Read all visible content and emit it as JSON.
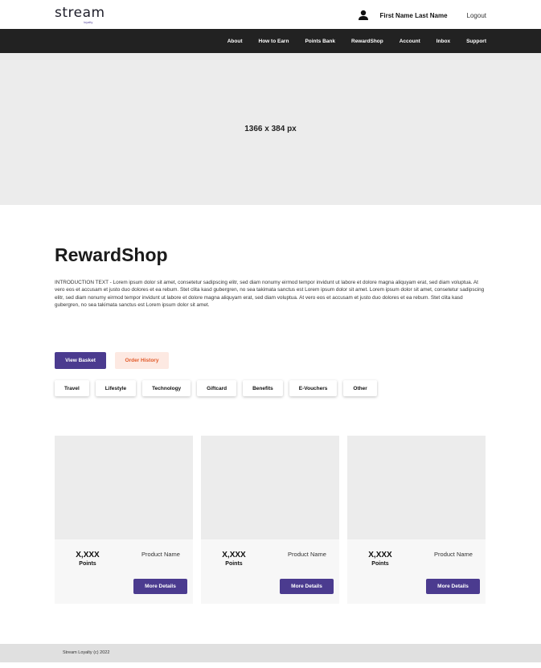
{
  "header": {
    "logo_text": "stream",
    "logo_sub": "loyalty",
    "user_icon": "user-icon",
    "user_name": "First Name Last Name",
    "logout": "Logout"
  },
  "nav": {
    "items": [
      "About",
      "How to Earn",
      "Points Bank",
      "RewardShop",
      "Account",
      "Inbox",
      "Support"
    ]
  },
  "banner": {
    "text": "1366 x 384 px"
  },
  "main": {
    "title": "RewardShop",
    "intro": "INTRODUCTION TEXT - Lorem ipsum dolor sit amet, consetetur sadipscing elitr, sed diam nonumy eirmod tempor invidunt ut labore et dolore magna aliquyam erat, sed diam voluptua. At vero eos et accusam et justo duo dolores et ea rebum. Stet clita kasd gubergren, no sea takimata sanctus est Lorem ipsum dolor sit amet. Lorem ipsum dolor sit amet, consetetur sadipscing elitr, sed diam nonumy eirmod tempor invidunt ut labore et dolore magna aliquyam erat, sed diam voluptua. At vero eos et accusam et justo duo dolores et ea rebum. Stet clita kasd gubergren, no sea takimata sanctus est Lorem ipsum dolor sit amet.",
    "view_basket": "View Basket",
    "order_history": "Order History",
    "categories": [
      "Travel",
      "Lifestyle",
      "Technology",
      "Giftcard",
      "Benefits",
      "E-Vouchers",
      "Other"
    ]
  },
  "products": [
    {
      "price": "X,XXX",
      "points_label": "Points",
      "name": "Product Name",
      "button": "More Details"
    },
    {
      "price": "X,XXX",
      "points_label": "Points",
      "name": "Product Name",
      "button": "More Details"
    },
    {
      "price": "X,XXX",
      "points_label": "Points",
      "name": "Product Name",
      "button": "More Details"
    }
  ],
  "footer": {
    "text": "Stream Loyalty (c) 2022"
  },
  "colors": {
    "primary": "#4b3b8f",
    "secondary_bg": "#fde9e2",
    "secondary_text": "#e25a2a",
    "nav_bg": "#222222"
  }
}
